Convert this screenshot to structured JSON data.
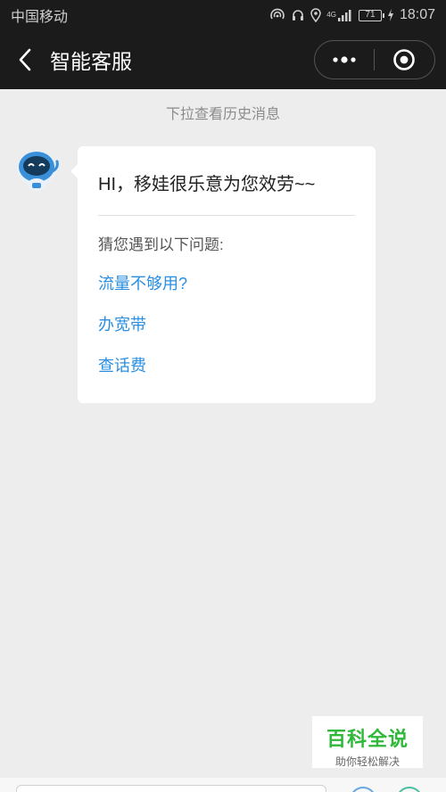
{
  "status_bar": {
    "carrier": "中国移动",
    "network": "4G",
    "battery": "71",
    "time": "18:07"
  },
  "nav": {
    "title": "智能客服"
  },
  "history_hint": "下拉查看历史消息",
  "message": {
    "greeting": "HI，移娃很乐意为您效劳~~",
    "intro": "猜您遇到以下问题:",
    "questions": [
      "流量不够用?",
      "办宽带",
      "查话费"
    ]
  },
  "watermark": {
    "title": "百科全说",
    "subtitle": "助你轻松解决"
  },
  "colors": {
    "link": "#2a8fe2",
    "nav_bg": "#1b1b1b",
    "page_bg": "#ededed",
    "watermark_green": "#2fb83a"
  }
}
